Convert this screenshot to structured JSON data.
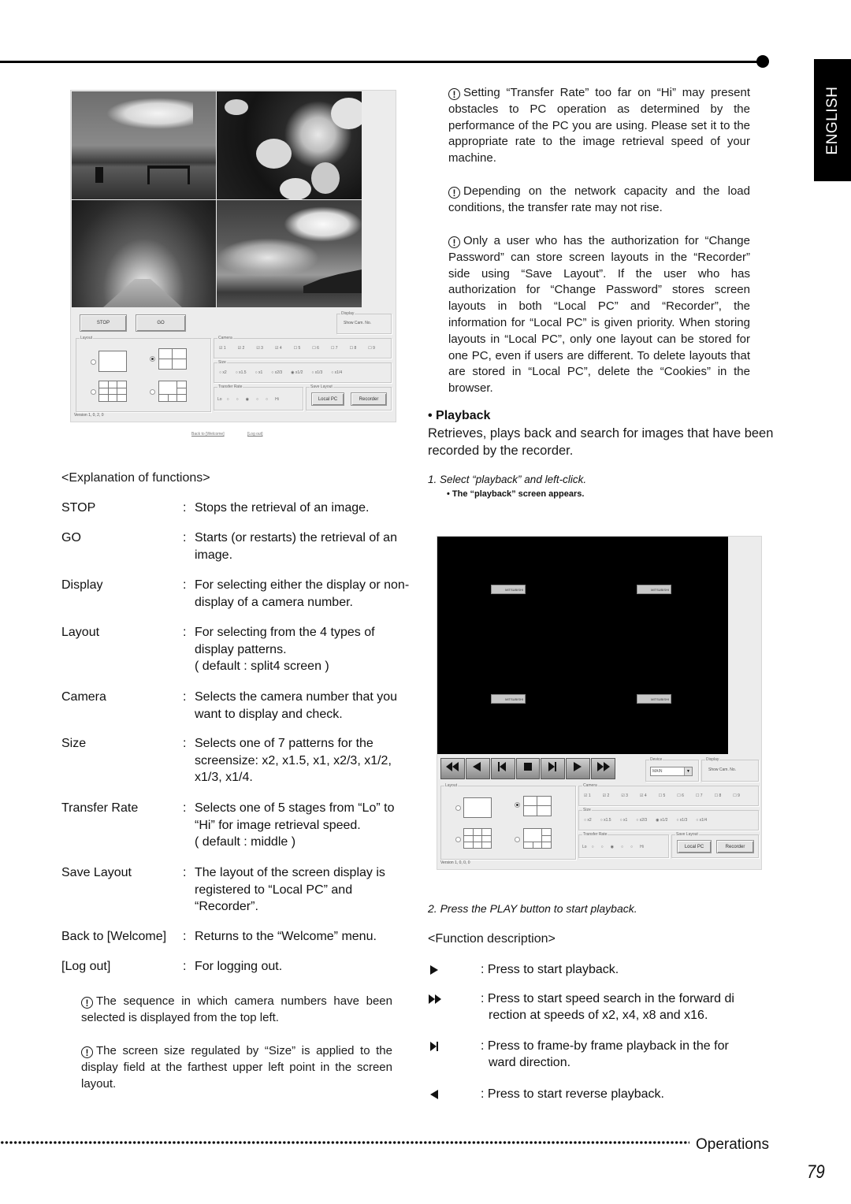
{
  "header": {
    "language_tab": "ENGLISH"
  },
  "left_screenshot": {
    "photos": [
      "bench-by-sea-photo",
      "cherry-blossom-photo",
      "tree-lined-path-photo",
      "cloudy-sky-photo"
    ],
    "buttons": {
      "stop": "STOP",
      "go": "GO"
    },
    "display_group": {
      "label": "Display",
      "checkbox": "Show Cam. No."
    },
    "layout_group": {
      "label": "Layout"
    },
    "camera_group": {
      "label": "Camera",
      "items": [
        "1",
        "2",
        "3",
        "4",
        "5",
        "6",
        "7",
        "8",
        "9"
      ],
      "checked": [
        true,
        true,
        true,
        true,
        false,
        false,
        false,
        false,
        false
      ]
    },
    "size_group": {
      "label": "Size",
      "items": [
        "x2",
        "x1.5",
        "x1",
        "x2/3",
        "x1/2",
        "x1/3",
        "x1/4"
      ],
      "selected": "x1/2"
    },
    "transfer_group": {
      "label": "Transfer Rate",
      "lo": "Lo",
      "hi": "Hi",
      "selected_stage": 3,
      "stages": 5
    },
    "save_layout_group": {
      "label": "Save Layout",
      "local_pc": "Local PC",
      "recorder": "Recorder"
    },
    "version": "Version 1, 0, 2, 0",
    "links": {
      "back": "Back to [Welcome]",
      "logout": "[Log out]"
    }
  },
  "explanation": {
    "heading": "<Explanation of functions>",
    "rows": [
      {
        "term": "STOP",
        "desc": "Stops the retrieval of an image."
      },
      {
        "term": "GO",
        "desc": "Starts (or restarts) the retrieval of an image."
      },
      {
        "term": "Display",
        "desc": "For selecting either the display or non-display of a camera number."
      },
      {
        "term": "Layout",
        "desc": "For selecting from the 4 types of display patterns.",
        "extra": "( default : split4 screen )"
      },
      {
        "term": "Camera",
        "desc": "Selects the camera number that you want to display and check."
      },
      {
        "term": "Size",
        "desc": "Selects one of 7 patterns for the screensize: x2, x1.5, x1, x2/3, x1/2, x1/3, x1/4."
      },
      {
        "term": "Transfer Rate",
        "desc": "Selects one of 5 stages from “Lo” to “Hi” for image retrieval speed.",
        "extra": "( default : middle )"
      },
      {
        "term": "Save Layout",
        "desc": "The layout of the screen display is registered to “Local PC” and “Recorder”."
      },
      {
        "term": "Back to [Welcome]",
        "desc": "Returns to the “Welcome”  menu."
      },
      {
        "term": "[Log out]",
        "desc": "For logging out."
      }
    ],
    "notes": [
      "The sequence in which camera numbers have been selected is displayed from the top left.",
      "The screen size regulated by “Size” is applied to the display field at the farthest upper left point in the screen layout."
    ]
  },
  "right_notes": [
    "Setting “Transfer Rate” too far on “Hi” may present obstacles to PC operation as determined by the performance of the PC you are using. Please set it to the appropriate rate to the image retrieval speed of your machine.",
    "Depending on the network capacity and the load conditions, the transfer rate may not rise.",
    "Only a user who has the authorization for “Change Password” can store screen layouts in the “Recorder” side using “Save Layout”. If the user who has authorization for “Change Password” stores screen layouts in both “Local PC” and “Recorder”, the information for “Local PC” is given priority. When storing layouts in “Local PC”, only one layout can be stored for one PC, even if users are different. To delete layouts that are stored in “Local PC”, delete the “Cookies” in the browser."
  ],
  "playback": {
    "heading": "• Playback",
    "intro": "Retrieves, plays back and search for images that have been recorded by the recorder.",
    "step1": "1. Select “playback” and left-click.",
    "step1_sub": "• The “playback” screen appears.",
    "step2": "2. Press the PLAY button to start playback.",
    "screenshot": {
      "logo_text": "MITSUBISHI",
      "transport_buttons": [
        "fast-reverse",
        "reverse-play",
        "frame-back",
        "stop",
        "frame-forward",
        "play",
        "fast-forward"
      ],
      "device_group": {
        "label": "Device",
        "value": "MAIN"
      },
      "display_group": {
        "label": "Display",
        "checkbox": "Show Cam. No."
      },
      "layout_group": {
        "label": "Layout"
      },
      "camera_group": {
        "label": "Camera",
        "items": [
          "1",
          "2",
          "3",
          "4",
          "5",
          "6",
          "7",
          "8",
          "9"
        ],
        "checked": [
          true,
          true,
          true,
          true,
          false,
          false,
          false,
          false,
          false
        ]
      },
      "size_group": {
        "label": "Size",
        "items": [
          "x2",
          "x1.5",
          "x1",
          "x2/3",
          "x1/2",
          "x1/3",
          "x1/4"
        ],
        "selected": "x1/2"
      },
      "transfer_group": {
        "label": "Transfer Rate",
        "lo": "Lo",
        "hi": "Hi",
        "selected_stage": 3,
        "stages": 5
      },
      "save_layout_group": {
        "label": "Save Layout",
        "local_pc": "Local PC",
        "recorder": "Recorder"
      },
      "version": "Version 1, 0, 0, 0"
    },
    "function_heading": "<Function description>",
    "functions": [
      {
        "icon": "play",
        "desc": "Press to start playback."
      },
      {
        "icon": "fast-forward",
        "desc": "Press to start speed search in the forward di",
        "desc2": "rection at speeds of x2, x4, x8 and x16."
      },
      {
        "icon": "frame-forward",
        "desc": "Press to frame-by frame playback in the for",
        "desc2": "ward direction."
      },
      {
        "icon": "reverse-play",
        "desc": "Press to start reverse playback."
      }
    ]
  },
  "footer": {
    "section": "Operations",
    "page_number": "79"
  }
}
